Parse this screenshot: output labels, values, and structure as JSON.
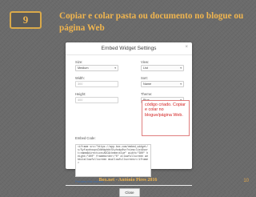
{
  "slide": {
    "number": "9",
    "title": "Copiar e colar pasta ou documento no blogue ou página Web",
    "footer": "Box.net - António Pires 2016",
    "page_number": "10"
  },
  "dialog": {
    "title": "Embed Widget Settings",
    "close_symbol": "×",
    "fields": {
      "size": {
        "label": "Size:",
        "value": "Medium"
      },
      "view": {
        "label": "View:",
        "value": "List"
      },
      "width": {
        "label": "Width:",
        "placeholder": "300"
      },
      "sort": {
        "label": "Sort:",
        "value": "Name"
      },
      "height": {
        "label": "Height:",
        "placeholder": "400"
      },
      "theme": {
        "label": "Theme:",
        "value": "Blue"
      }
    },
    "embed_code_label": "Embed Code:",
    "embed_code": "<iframe src=\"https://app.box.com/embed_widget/s/5yfuuxhoupvZdbhkpbbt5tyhokp8vx?view=list&sort=name&direction=ASC&theme=blue\" width=\"300\" height=\"400\" frameborder=\"0\" allowfullscreen webkitallowfullscreen msallowfullscreen></iframe>",
    "preview_link": "Preview this embed",
    "close_button": "Close"
  },
  "callout": {
    "text": "código criado. Copiar e colar no blogue/página Web."
  }
}
